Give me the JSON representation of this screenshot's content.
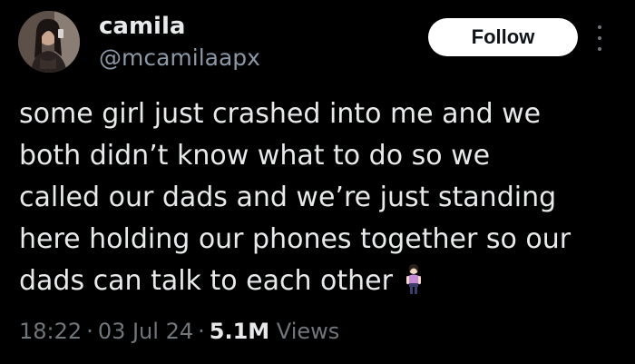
{
  "author": {
    "display_name": "camila",
    "handle": "@mcamilaapx",
    "avatar_icon": "profile-photo"
  },
  "follow_button": {
    "label": "Follow"
  },
  "more_menu": {
    "icon": "more-vertical-icon"
  },
  "tweet": {
    "text": "some girl just crashed into me and we\nboth didn’t know what to do so we\ncalled our dads and we’re just standing\nhere holding our phones together so our\ndads can talk to each other",
    "emoji": "standing-woman-emoji"
  },
  "meta": {
    "time": "18:22",
    "separator": "·",
    "date": "03 Jul 24",
    "views_count": "5.1M",
    "views_label": "Views"
  },
  "colors": {
    "background": "#000000",
    "primary_text": "#e7e9ea",
    "secondary_text": "#71767b",
    "handle_text": "#8b98a5",
    "follow_bg": "#ffffff"
  }
}
